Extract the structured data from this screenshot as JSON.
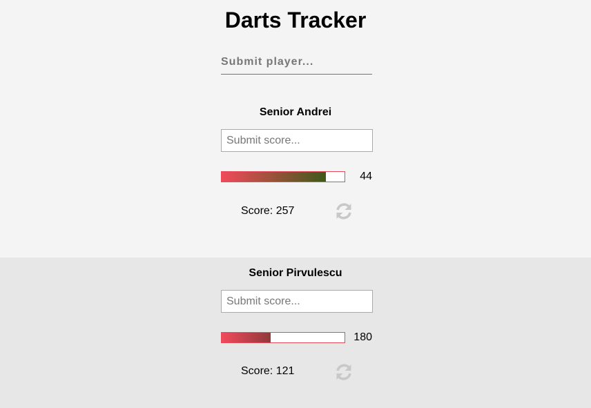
{
  "app": {
    "title": "Darts Tracker"
  },
  "player_input": {
    "placeholder": "Submit player..."
  },
  "players": [
    {
      "name": "Senior Andrei",
      "score_placeholder": "Submit score...",
      "remaining": "44",
      "progress_fraction": 0.85,
      "progress_end_color": "#3e5a1a",
      "score_label": "Score: 257",
      "reset_icon": "refresh-icon"
    },
    {
      "name": "Senior Pirvulescu",
      "score_placeholder": "Submit score...",
      "remaining": "180",
      "progress_fraction": 0.4,
      "progress_end_color": "#8f3a3a",
      "score_label": "Score: 121",
      "reset_icon": "refresh-icon"
    }
  ],
  "colors": {
    "progress_start": "#f24a5a",
    "progress_border": "#e64a5a",
    "input_underline": "#2ea12e",
    "icon": "#c8c8c8"
  }
}
